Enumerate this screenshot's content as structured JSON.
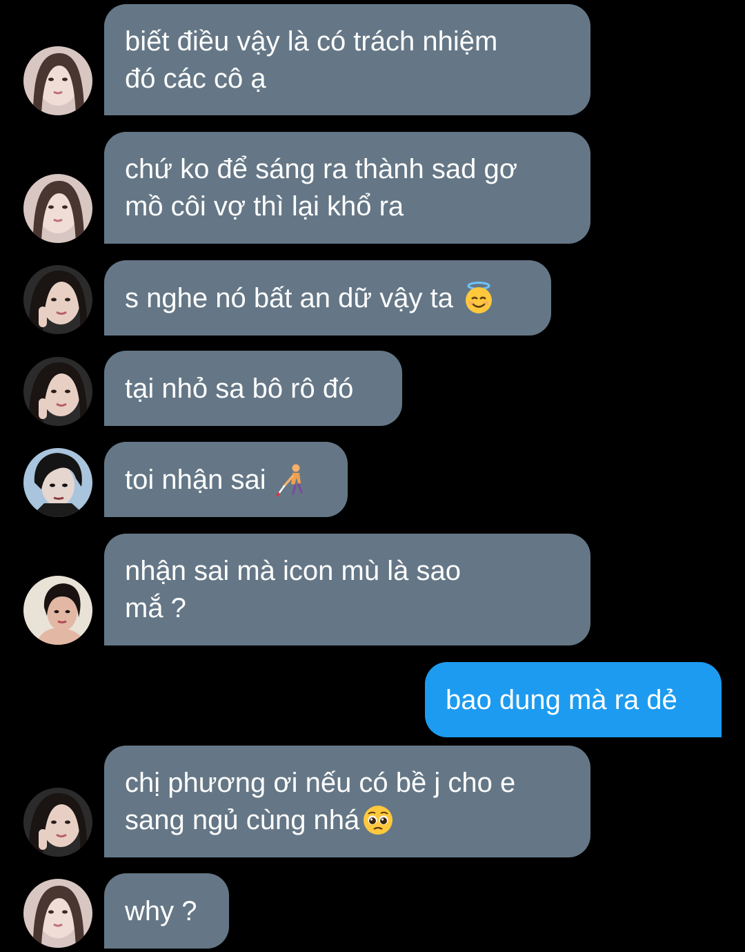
{
  "messages": [
    {
      "text": "biết điều vậy là có trách nhiệm\nđó các cô ạ"
    },
    {
      "text": "chứ ko để sáng ra thành sad gơ\nmồ côi vợ thì lại khổ ra"
    },
    {
      "text": "s nghe nó bất an dữ vậy ta",
      "emoji": "smiling-face-with-halo-emoji"
    },
    {
      "text": "tại nhỏ sa bô rô đó"
    },
    {
      "text": "toi nhận sai",
      "emoji": "person-with-white-cane-emoji"
    },
    {
      "text": "nhận sai mà icon mù là sao\nmắ ?"
    },
    {
      "text": "bao dung mà ra dẻ",
      "outgoing": true
    },
    {
      "text": "chị phương ơi nếu có bề j cho e\nsang ngủ cùng nhá",
      "emoji": "pleading-face-emoji"
    },
    {
      "text": "why ?"
    }
  ],
  "colors": {
    "background": "#000000",
    "incoming_bubble": "#657786",
    "outgoing_bubble": "#1d9bf0",
    "text": "#ffffff"
  }
}
